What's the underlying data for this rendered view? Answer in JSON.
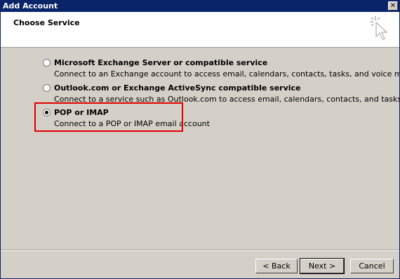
{
  "window": {
    "title": "Add Account",
    "close_glyph": "✕"
  },
  "header": {
    "title": "Choose Service",
    "icon": "cursor-sparkle-icon"
  },
  "options": [
    {
      "label": "Microsoft Exchange Server or compatible service",
      "description": "Connect to an Exchange account to access email, calendars, contacts, tasks, and voice mail",
      "selected": false
    },
    {
      "label": "Outlook.com or Exchange ActiveSync compatible service",
      "description": "Connect to a service such as Outlook.com to access email, calendars, contacts, and tasks",
      "selected": false
    },
    {
      "label": "POP or IMAP",
      "description": "Connect to a POP or IMAP email account",
      "selected": true
    }
  ],
  "buttons": {
    "back": "< Back",
    "next": "Next >",
    "cancel": "Cancel"
  },
  "colors": {
    "highlight": "#e00000",
    "titlebar": "#0a246a"
  }
}
